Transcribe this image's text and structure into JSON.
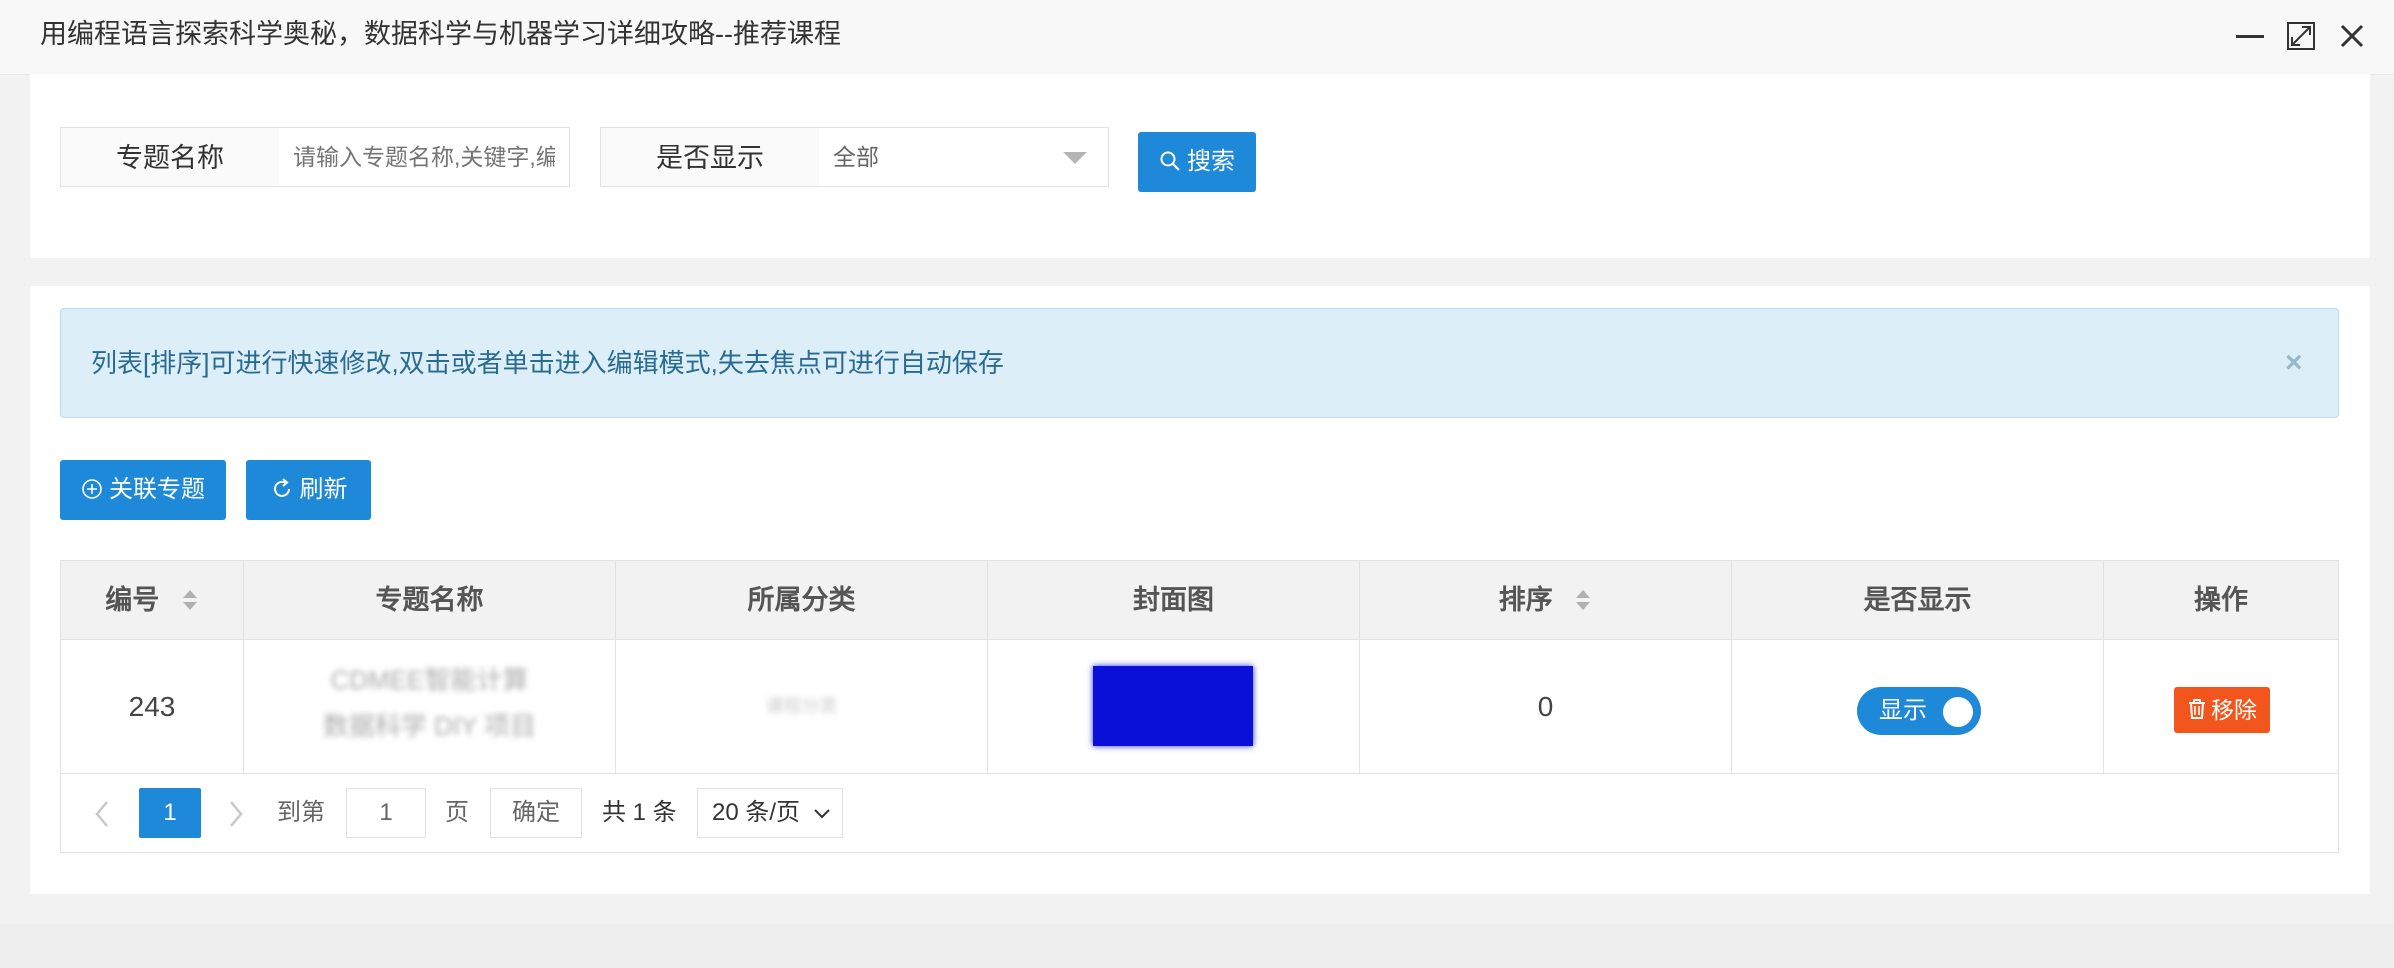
{
  "window": {
    "title": "用编程语言探索科学奥秘，数据科学与机器学习详细攻略--推荐课程"
  },
  "search": {
    "topic_label": "专题名称",
    "topic_placeholder": "请输入专题名称,关键字,编号",
    "display_label": "是否显示",
    "display_value": "全部",
    "search_button": "搜索"
  },
  "alert": {
    "message": "列表[排序]可进行快速修改,双击或者单击进入编辑模式,失去焦点可进行自动保存",
    "close": "×"
  },
  "toolbar": {
    "link_button": "关联专题",
    "refresh_button": "刷新"
  },
  "table": {
    "headers": [
      "编号",
      "专题名称",
      "所属分类",
      "封面图",
      "排序",
      "是否显示",
      "操作"
    ],
    "rows": [
      {
        "id": "243",
        "name_line1": "CDMEE智能计算",
        "name_line2": "数据科学 DIY 项目",
        "category": "课程分类",
        "sort": "0",
        "display": "显示",
        "action": "移除"
      }
    ]
  },
  "pagination": {
    "current_page": "1",
    "goto_label": "到第",
    "goto_value": "1",
    "page_unit": "页",
    "confirm": "确定",
    "total": "共 1 条",
    "page_size": "20 条/页"
  },
  "colors": {
    "primary": "#1e88d9",
    "danger": "#f2561d",
    "alert_bg": "#dceef8",
    "cover": "#0a10d8"
  }
}
